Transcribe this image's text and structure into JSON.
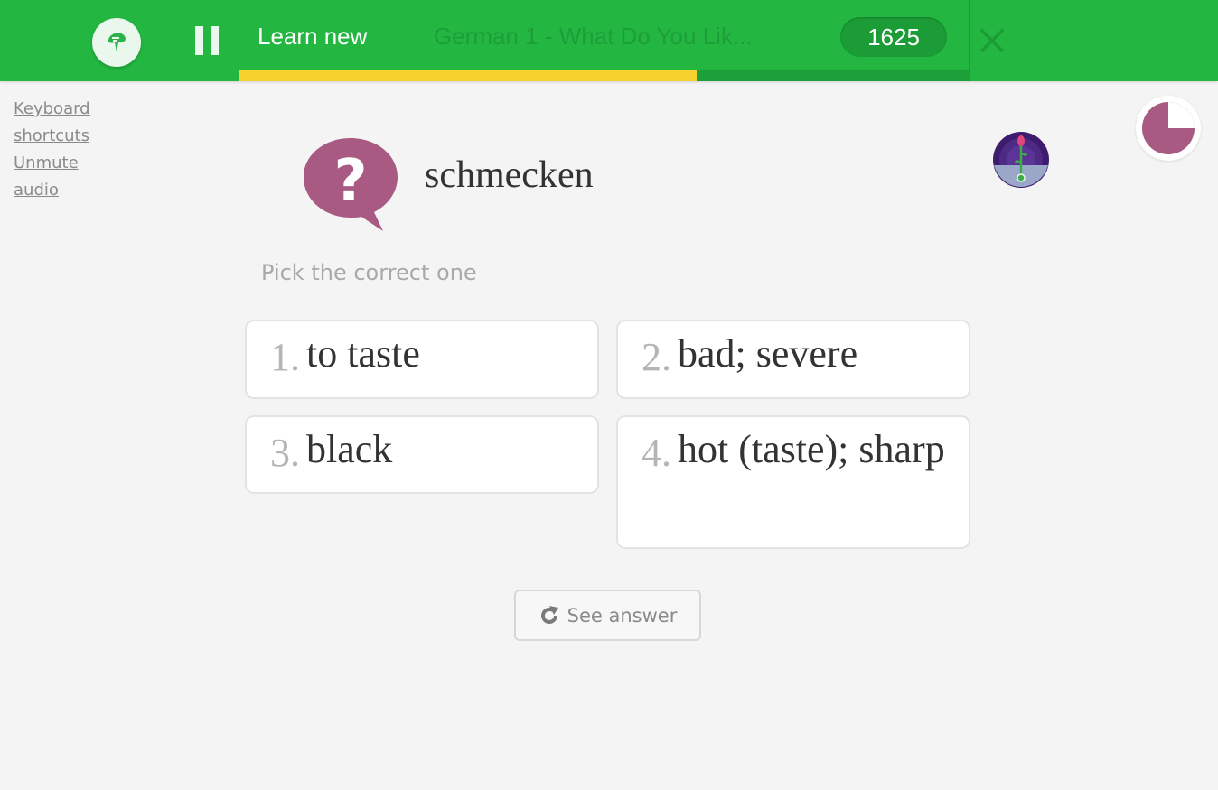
{
  "header": {
    "mode_label": "Learn new",
    "course_title": "German 1 - What Do You Lik...",
    "points": "1625",
    "progress_fraction": 0.627,
    "colors": {
      "bar": "#23b742",
      "progress": "#f6d22f"
    },
    "icons": {
      "logo": "memrise-logo-icon",
      "pause": "pause-icon",
      "close": "close-icon"
    }
  },
  "sidebar": {
    "links": [
      "Keyboard shortcuts",
      "Unmute audio"
    ]
  },
  "timer": {
    "fraction_elapsed": 0.75,
    "color": "#a85a83"
  },
  "prompt": {
    "word": "schmecken",
    "icon": "question-bubble-icon",
    "avatar": "plant-avatar-icon",
    "instruction": "Pick the correct one"
  },
  "choices": [
    {
      "num": "1.",
      "text": "to taste"
    },
    {
      "num": "2.",
      "text": "bad; severe"
    },
    {
      "num": "3.",
      "text": "black"
    },
    {
      "num": "4.",
      "text": "hot (taste); sharp"
    }
  ],
  "see_answer": {
    "label": "See answer",
    "icon": "refresh-icon"
  }
}
